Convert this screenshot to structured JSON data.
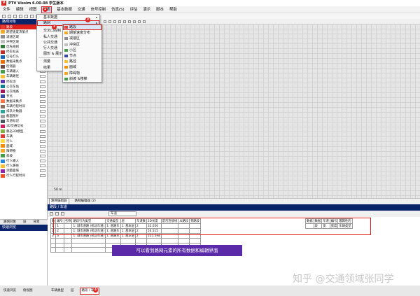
{
  "window": {
    "title": "PTV Vissim 6.00-08 学生版本",
    "logo": "V"
  },
  "menubar": {
    "items": [
      "文件",
      "编辑",
      "视图",
      "列表",
      "基本数据",
      "交通",
      "信号控制",
      "仿真(S)",
      "评估",
      "演示",
      "脚本",
      "帮助"
    ],
    "selected_index": 3,
    "badge_1": "1"
  },
  "left_panel": {
    "header": "路网对象",
    "items": [
      {
        "label": "路段",
        "color": "#e63b2e"
      },
      {
        "label": "期望速度决策点",
        "color": "#f5a623"
      },
      {
        "label": "减速区域",
        "color": "#8e8e8e"
      },
      {
        "label": "冲突区域",
        "color": "#c0c0c0"
      },
      {
        "label": "优先规则",
        "color": "#2e7d32"
      },
      {
        "label": "停车标志",
        "color": "#c62828"
      },
      {
        "label": "信号灯头",
        "color": "#1565c0"
      },
      {
        "label": "数据采集点",
        "color": "#ef6c00"
      },
      {
        "label": "检测器",
        "color": "#6d4c41"
      },
      {
        "label": "车辆输入",
        "color": "#43a047"
      },
      {
        "label": "车辆路径",
        "color": "#fbc02d"
      },
      {
        "label": "停车场",
        "color": "#5e35b1"
      },
      {
        "label": "公交车站",
        "color": "#00838f"
      },
      {
        "label": "公交线路",
        "color": "#ad1457"
      },
      {
        "label": "节点",
        "color": "#3949ab"
      },
      {
        "label": "数据采集点",
        "color": "#ff7043"
      },
      {
        "label": "车辆行程时间",
        "color": "#8d6e63"
      },
      {
        "label": "排队计数器",
        "color": "#26a69a"
      },
      {
        "label": "截面图片",
        "color": "#9e9e9e"
      },
      {
        "label": "车道标记",
        "color": "#455a64"
      },
      {
        "label": "3D交通信号",
        "color": "#d81b60"
      },
      {
        "label": "静态3D模型",
        "color": "#7cb342"
      },
      {
        "label": "车辆",
        "color": "#e53935"
      },
      {
        "label": "行人",
        "color": "#fdd835"
      },
      {
        "label": "面域",
        "color": "#fb8c00"
      },
      {
        "label": "障碍物",
        "color": "#f9a825"
      },
      {
        "label": "斜坡",
        "color": "#43a047"
      },
      {
        "label": "行人输入",
        "color": "#1e88e5"
      },
      {
        "label": "行人路径",
        "color": "#fbc02d"
      },
      {
        "label": "测量面域",
        "color": "#8e24aa"
      },
      {
        "label": "行人行程时间",
        "color": "#f4511e"
      }
    ],
    "tabs": [
      "路网对象",
      "层",
      "背景"
    ]
  },
  "quick_view": {
    "header": "快速浏览",
    "tabs": [
      "快速浏览",
      "俯视图"
    ]
  },
  "menu_level1": {
    "items": [
      {
        "label": "基本数据",
        "arrow": "▸"
      },
      {
        "label": "路网",
        "arrow": "▸"
      },
      {
        "label": "交叉口控制",
        "arrow": "▸"
      },
      {
        "label": "私人交通",
        "arrow": "▸"
      },
      {
        "label": "公共交通",
        "arrow": "▸"
      },
      {
        "label": "行人交通",
        "arrow": "▸"
      },
      {
        "label": "图形 & 展示",
        "arrow": "▸"
      },
      {
        "label": "测量",
        "arrow": "▸"
      },
      {
        "label": "结果",
        "arrow": "▸"
      }
    ],
    "badge": "2"
  },
  "menu_level2": {
    "items": [
      {
        "label": "路段",
        "color": "#e63b2e"
      },
      {
        "label": "期望速度分布",
        "color": "#f5a623"
      },
      {
        "label": "减速区",
        "color": "#8e8e8e"
      },
      {
        "label": "冲突区",
        "color": "#c0c0c0"
      },
      {
        "label": "小区",
        "color": "#43a047"
      },
      {
        "label": "节点",
        "color": "#3949ab"
      },
      {
        "label": "路径",
        "color": "#fbc02d"
      },
      {
        "label": "面域",
        "color": "#fb8c00"
      },
      {
        "label": "障碍物",
        "color": "#f9a825"
      },
      {
        "label": "斜坡 &楼梯",
        "color": "#43a047"
      }
    ],
    "badge": "3"
  },
  "network": {
    "scale": "50 m",
    "tabs": [
      "路网编辑器",
      "路网编辑器 (2)"
    ]
  },
  "list": {
    "header": "路段 / 车道",
    "selector": "车道",
    "columns": [
      "数",
      "编号",
      "名称",
      "路段行为类型",
      "交通类型",
      "层",
      "车道数",
      "2D长度",
      "是否连接线",
      "从路段",
      "到路段"
    ],
    "rows": [
      [
        "1",
        "1",
        "",
        "1: 城市道路 (机动车道)",
        "1: 道路车",
        "1: 基本层",
        "2",
        "32.056",
        "",
        "",
        ""
      ],
      [
        "2",
        "2",
        "",
        "1: 城市道路 (机动车道)",
        "1: 道路车",
        "1: 基本层",
        "2",
        "56.515",
        "",
        "",
        ""
      ],
      [
        "3",
        "3",
        "",
        "1: 城市道路 (机动车道)",
        "1: 道路车",
        "1: 基本层",
        "2",
        "125.598",
        "",
        "",
        ""
      ]
    ],
    "sub_columns_top": [
      "数据",
      "数据",
      "车道",
      "编号",
      "最属性的"
    ],
    "sub_columns_bottom": [
      "",
      "段",
      "宽",
      "宽度",
      "车辆类型"
    ]
  },
  "annotation": "可以看到路网元素的所有数据和编辑界面",
  "watermark": "知乎 @交通领域张同学",
  "bottom_tabs": {
    "items": [
      "车辆类型",
      "层",
      "路段 / 车道"
    ],
    "selected_index": 2,
    "badge": "4"
  }
}
